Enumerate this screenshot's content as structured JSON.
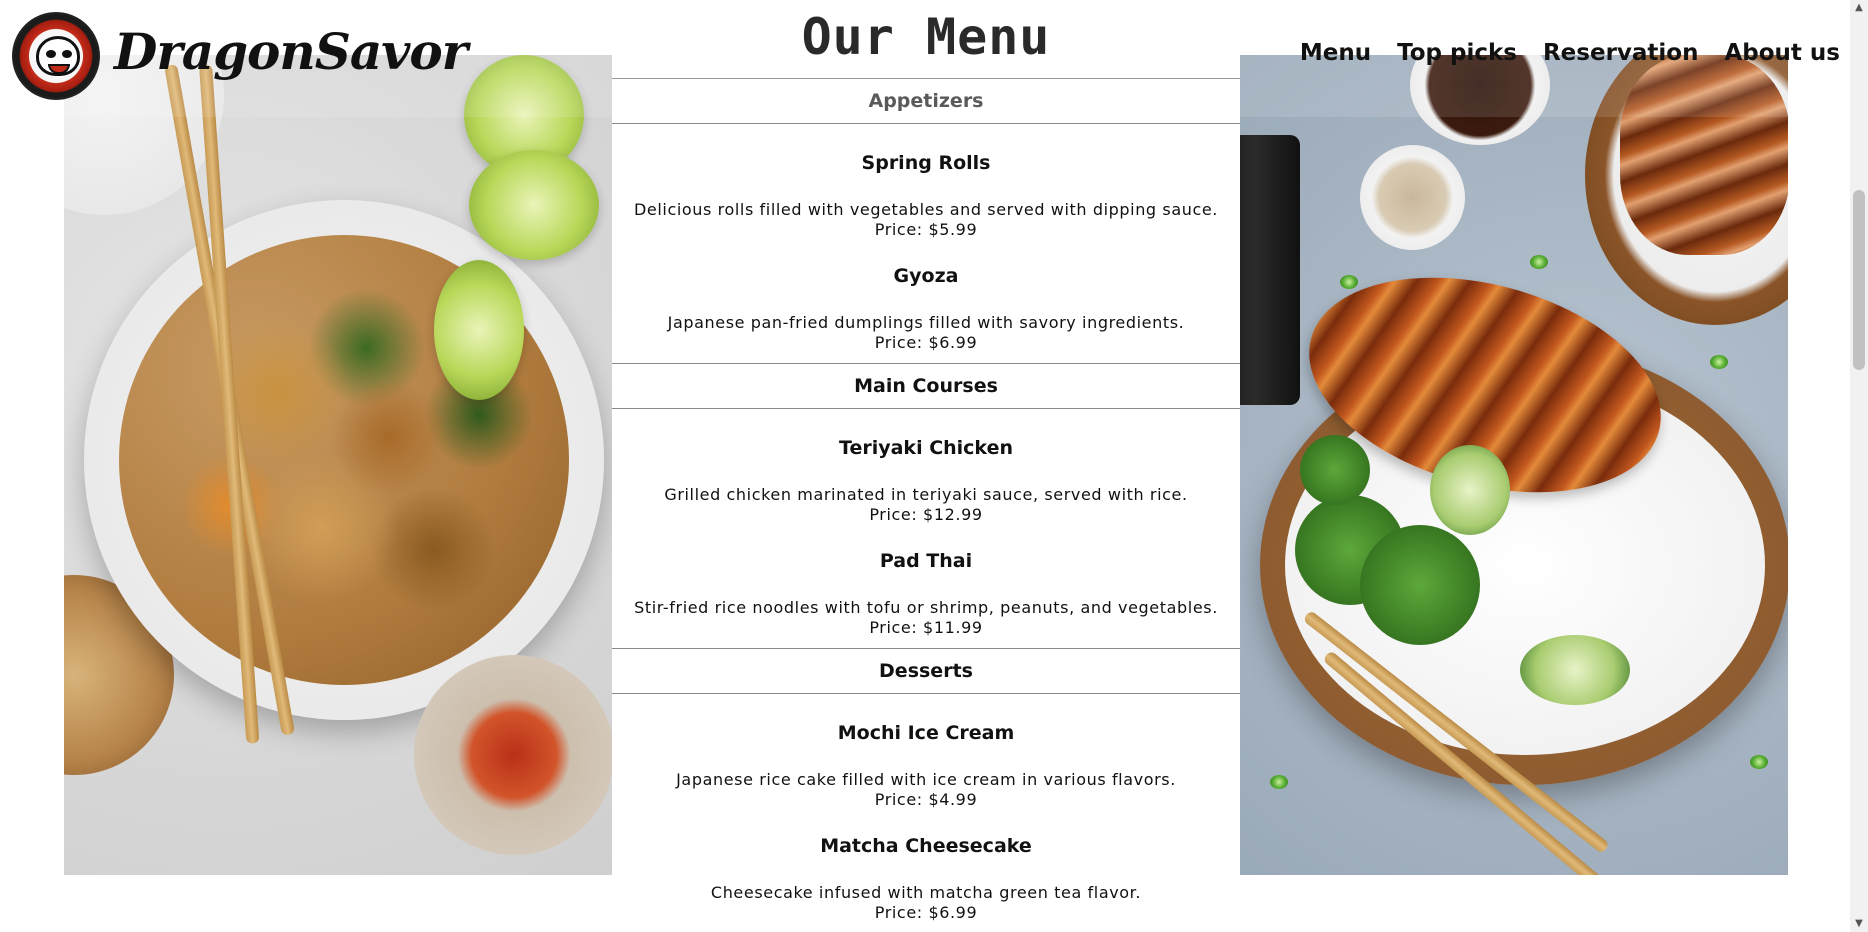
{
  "brand": {
    "name": "DragonSavor",
    "logo_icon": "dragon-chef-logo-icon"
  },
  "nav": {
    "links": [
      "Menu",
      "Top picks",
      "Reservation",
      "About us"
    ]
  },
  "menu": {
    "title": "Our Menu",
    "sections": [
      {
        "name": "Appetizers",
        "items": [
          {
            "name": "Spring Rolls",
            "description": "Delicious rolls filled with vegetables and served with dipping sauce.",
            "price": "Price: $5.99"
          },
          {
            "name": "Gyoza",
            "description": "Japanese pan-fried dumplings filled with savory ingredients.",
            "price": "Price: $6.99"
          }
        ]
      },
      {
        "name": "Main Courses",
        "items": [
          {
            "name": "Teriyaki Chicken",
            "description": "Grilled chicken marinated in teriyaki sauce, served with rice.",
            "price": "Price: $12.99"
          },
          {
            "name": "Pad Thai",
            "description": "Stir-fried rice noodles with tofu or shrimp, peanuts, and vegetables.",
            "price": "Price: $11.99"
          }
        ]
      },
      {
        "name": "Desserts",
        "items": [
          {
            "name": "Mochi Ice Cream",
            "description": "Japanese rice cake filled with ice cream in various flavors.",
            "price": "Price: $4.99"
          },
          {
            "name": "Matcha Cheesecake",
            "description": "Cheesecake infused with matcha green tea flavor.",
            "price": "Price: $6.99"
          }
        ]
      }
    ]
  },
  "images": {
    "left": "pad-thai-bowl-photo",
    "right": "teriyaki-chicken-bowl-photo"
  },
  "colors": {
    "text": "#111111",
    "divider": "#8a8a8a",
    "background": "#ffffff"
  }
}
